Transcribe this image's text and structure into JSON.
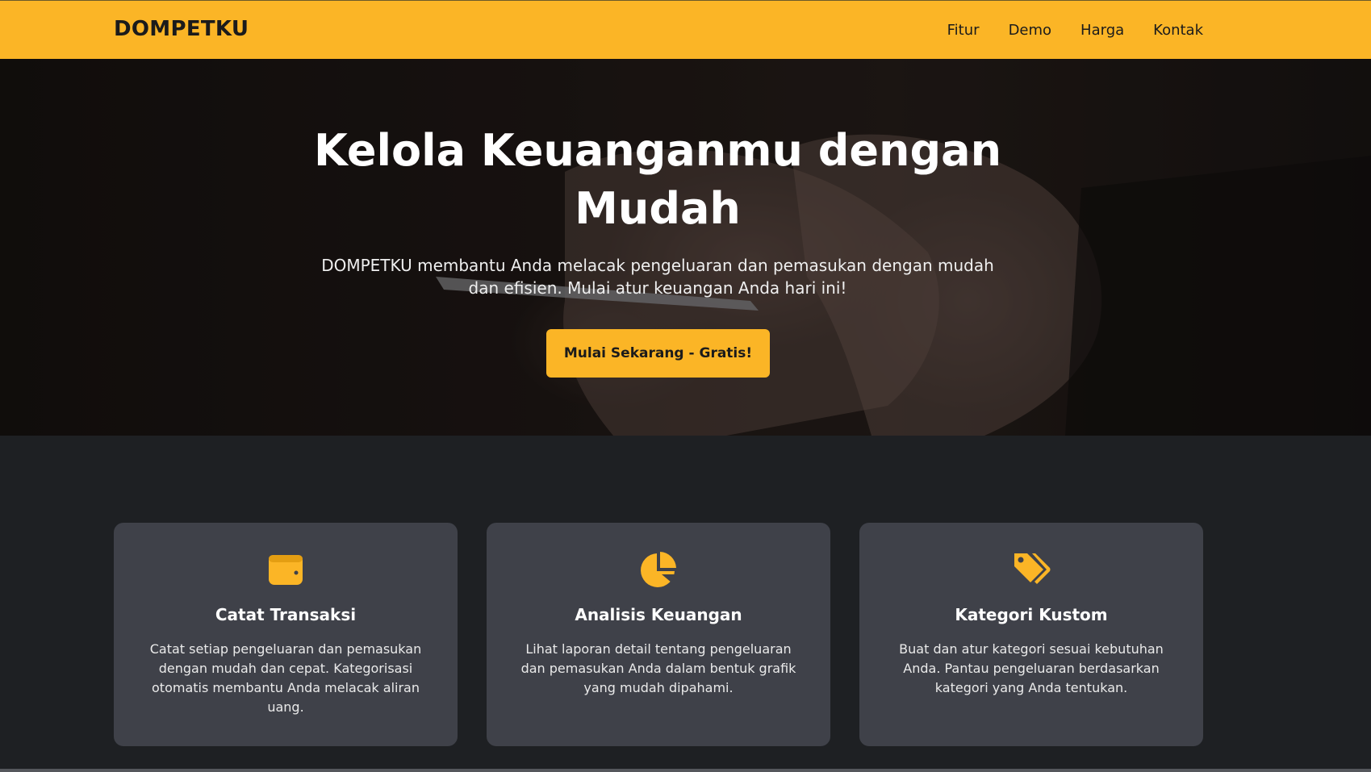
{
  "nav": {
    "brand": "DOMPETKU",
    "links": [
      {
        "label": "Fitur"
      },
      {
        "label": "Demo"
      },
      {
        "label": "Harga"
      },
      {
        "label": "Kontak"
      }
    ]
  },
  "hero": {
    "title_line1": "Kelola Keuanganmu dengan",
    "title_line2": "Mudah",
    "subtitle": "DOMPETKU membantu Anda melacak pengeluaran dan pemasukan dengan mudah dan efisien. Mulai atur keuangan Anda hari ini!",
    "cta_label": "Mulai Sekarang - Gratis!"
  },
  "features": [
    {
      "icon": "wallet-icon",
      "title": "Catat Transaksi",
      "description": "Catat setiap pengeluaran dan pemasukan dengan mudah dan cepat. Kategorisasi otomatis membantu Anda melacak aliran uang."
    },
    {
      "icon": "pie-chart-icon",
      "title": "Analisis Keuangan",
      "description": "Lihat laporan detail tentang pengeluaran dan pemasukan Anda dalam bentuk grafik yang mudah dipahami."
    },
    {
      "icon": "tags-icon",
      "title": "Kategori Kustom",
      "description": "Buat dan atur kategori sesuai kebutuhan Anda. Pantau pengeluaran berdasarkan kategori yang Anda tentukan."
    }
  ],
  "colors": {
    "accent": "#fbb526",
    "card_bg": "#3f4149",
    "page_bg": "#1e2023"
  }
}
